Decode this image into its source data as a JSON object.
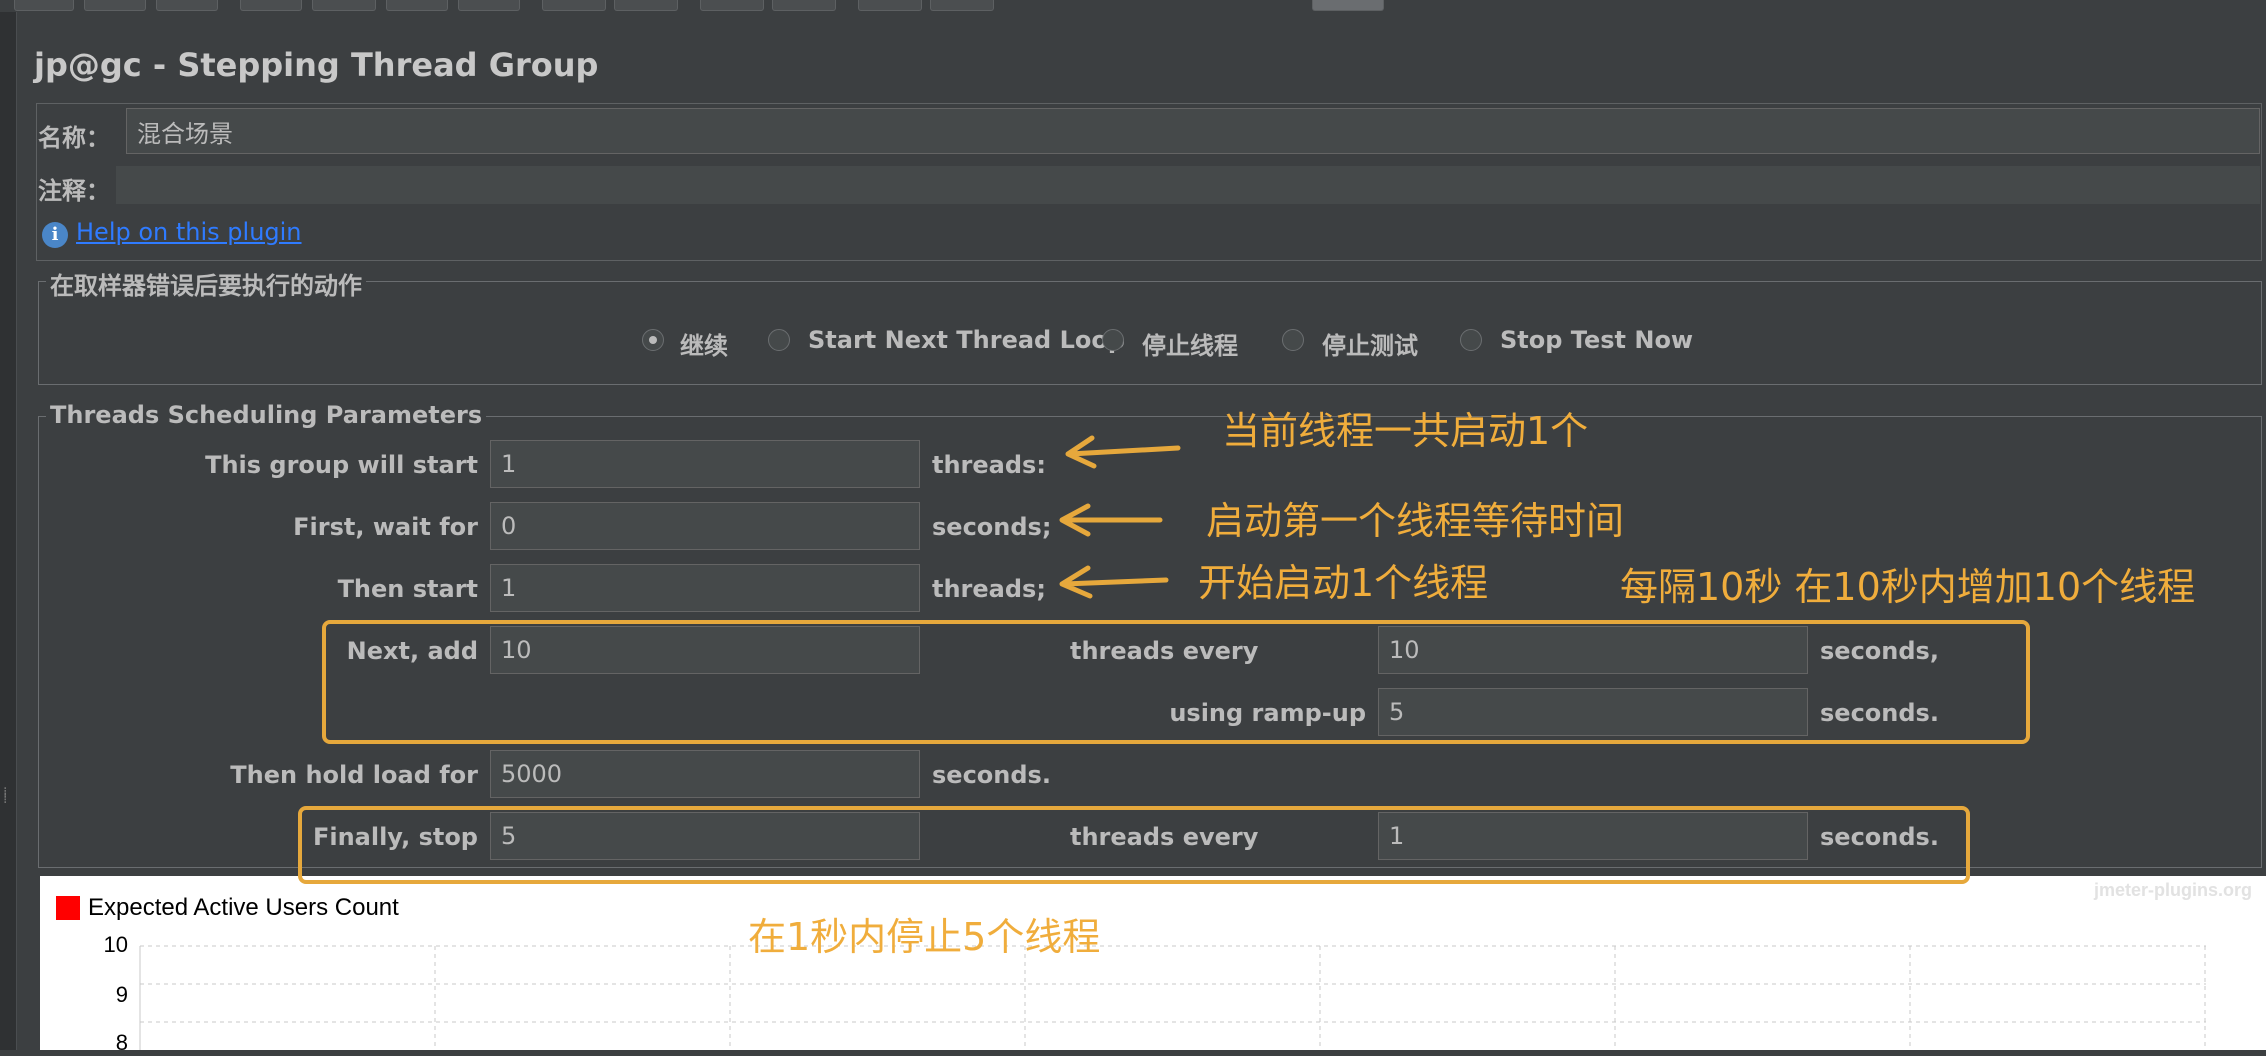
{
  "window": {
    "title": "jp@gc - Stepping Thread Group"
  },
  "name_row": {
    "label": "名称：",
    "value": "混合场景"
  },
  "comment_row": {
    "label": "注释：",
    "value": ""
  },
  "help": {
    "icon": "info-icon",
    "link_text": "Help on this plugin"
  },
  "error_action": {
    "title": "在取样器错误后要执行的动作",
    "options": [
      {
        "label": "继续",
        "checked": true
      },
      {
        "label": "Start Next Thread Loop",
        "checked": false
      },
      {
        "label": "停止线程",
        "checked": false
      },
      {
        "label": "停止测试",
        "checked": false
      },
      {
        "label": "Stop Test Now",
        "checked": false
      }
    ]
  },
  "scheduling": {
    "title": "Threads Scheduling Parameters",
    "group_will_start": {
      "label": "This group will start",
      "value": "1",
      "unit": "threads:"
    },
    "first_wait": {
      "label": "First, wait for",
      "value": "0",
      "unit": "seconds;"
    },
    "then_start": {
      "label": "Then start",
      "value": "1",
      "unit": "threads;"
    },
    "next_add": {
      "label": "Next, add",
      "value": "10",
      "mid_label": "threads every",
      "every_value": "10",
      "unit": "seconds,"
    },
    "ramp_up": {
      "label": "using ramp-up",
      "value": "5",
      "unit": "seconds."
    },
    "hold_load": {
      "label": "Then hold load for",
      "value": "5000",
      "unit": "seconds."
    },
    "finally_stop": {
      "label": "Finally, stop",
      "value": "5",
      "mid_label": "threads every",
      "every_value": "1",
      "unit": "seconds."
    }
  },
  "annotations": {
    "a1": "当前线程一共启动1个",
    "a2": "启动第一个线程等待时间",
    "a3": "开始启动1个线程",
    "a4": "每隔10秒  在10秒内增加10个线程",
    "a5": "在1秒内停止5个线程",
    "color": "#f0ad3c"
  },
  "chart_data": {
    "type": "line",
    "series": [
      {
        "name": "Expected Active Users Count",
        "color": "#ff0000",
        "values": []
      }
    ],
    "y_ticks": [
      "10",
      "9",
      "8"
    ],
    "watermark": "jmeter-plugins.org",
    "grid": true
  }
}
